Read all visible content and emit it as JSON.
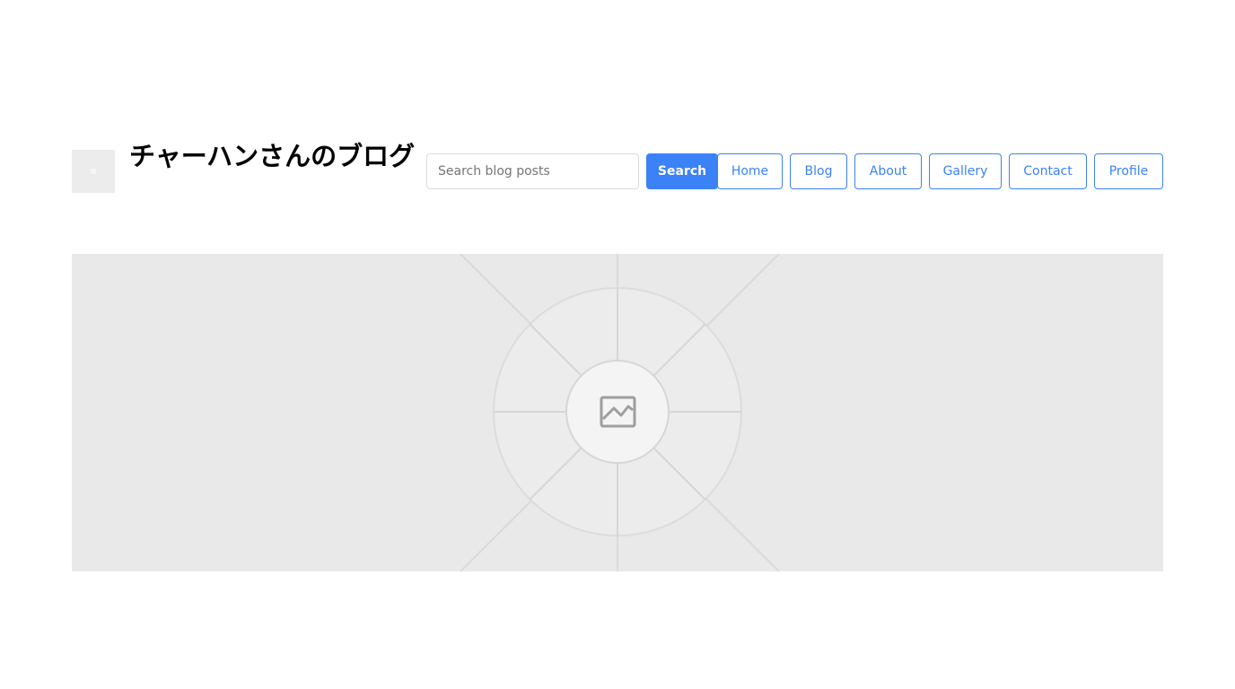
{
  "header": {
    "site_title": "チャーハンさんのブログ",
    "logo_icon": "logo-placeholder-icon"
  },
  "search": {
    "placeholder": "Search blog posts",
    "value": "",
    "button_label": "Search"
  },
  "nav": {
    "items": [
      {
        "label": "Home"
      },
      {
        "label": "Blog"
      },
      {
        "label": "About"
      },
      {
        "label": "Gallery"
      },
      {
        "label": "Contact"
      },
      {
        "label": "Profile"
      }
    ]
  },
  "hero": {
    "icon": "image-placeholder-icon"
  },
  "colors": {
    "accent": "#3b82f6",
    "placeholder_bg": "#e9e9e9",
    "text": "#000000"
  }
}
